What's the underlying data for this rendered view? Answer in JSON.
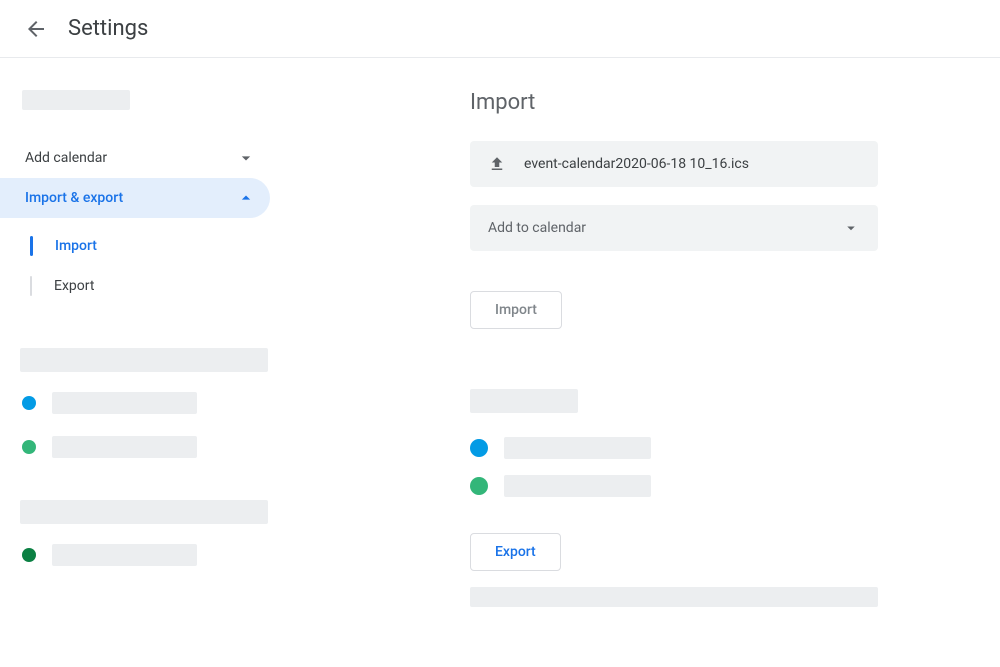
{
  "header": {
    "title": "Settings"
  },
  "sidebar": {
    "add_calendar_label": "Add calendar",
    "import_export_label": "Import & export",
    "sub_items": {
      "import": "Import",
      "export": "Export"
    }
  },
  "main": {
    "import_title": "Import",
    "file_name": "event-calendar2020-06-18 10_16.ics",
    "add_to_calendar_label": "Add to calendar",
    "import_button": "Import",
    "export_button": "Export"
  },
  "colors": {
    "blue_dot": "#039be5",
    "green_dot": "#33b679",
    "dark_green_dot": "#0b8043",
    "accent": "#1a73e8"
  }
}
